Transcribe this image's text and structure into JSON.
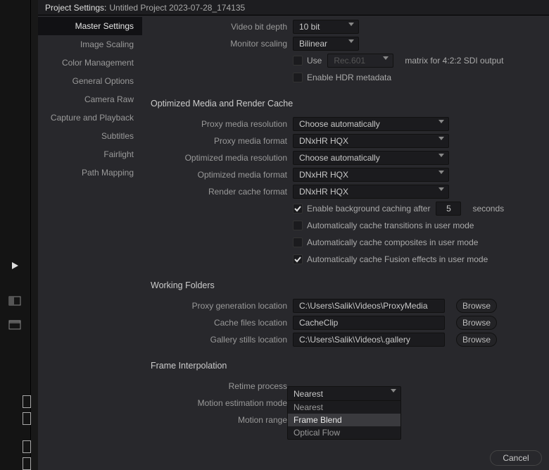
{
  "title": {
    "label": "Project Settings:",
    "project": "Untitled Project 2023-07-28_174135"
  },
  "sidebar": {
    "items": [
      "Master Settings",
      "Image Scaling",
      "Color Management",
      "General Options",
      "Camera Raw",
      "Capture and Playback",
      "Subtitles",
      "Fairlight",
      "Path Mapping"
    ]
  },
  "top": {
    "video_bit_depth_label": "Video bit depth",
    "video_bit_depth_value": "10 bit",
    "monitor_scaling_label": "Monitor scaling",
    "monitor_scaling_value": "Bilinear",
    "use_label": "Use",
    "matrix_select": "Rec.601",
    "matrix_tail": "matrix for 4:2:2 SDI output",
    "hdr_label": "Enable HDR metadata"
  },
  "sections": {
    "opt_head": "Optimized Media and Render Cache",
    "work_head": "Working Folders",
    "frame_head": "Frame Interpolation"
  },
  "optimized": {
    "proxy_res_label": "Proxy media resolution",
    "proxy_res_value": "Choose automatically",
    "proxy_fmt_label": "Proxy media format",
    "proxy_fmt_value": "DNxHR HQX",
    "opt_res_label": "Optimized media resolution",
    "opt_res_value": "Choose automatically",
    "opt_fmt_label": "Optimized media format",
    "opt_fmt_value": "DNxHR HQX",
    "cache_fmt_label": "Render cache format",
    "cache_fmt_value": "DNxHR HQX",
    "bg_cache_label": "Enable background caching after",
    "bg_cache_value": "5",
    "bg_cache_tail": "seconds",
    "auto_trans": "Automatically cache transitions in user mode",
    "auto_comp": "Automatically cache composites in user mode",
    "auto_fusion": "Automatically cache Fusion effects in user mode"
  },
  "folders": {
    "proxy_loc_label": "Proxy generation location",
    "proxy_loc_value": "C:\\Users\\Salik\\Videos\\ProxyMedia",
    "cache_loc_label": "Cache files location",
    "cache_loc_value": "CacheClip",
    "gallery_loc_label": "Gallery stills location",
    "gallery_loc_value": "C:\\Users\\Salik\\Videos\\.gallery",
    "browse": "Browse"
  },
  "frame": {
    "retime_label": "Retime process",
    "retime_value": "Nearest",
    "retime_options": [
      "Nearest",
      "Frame Blend",
      "Optical Flow"
    ],
    "motion_est_label": "Motion estimation mode",
    "motion_range_label": "Motion range"
  },
  "buttons": {
    "cancel": "Cancel"
  }
}
